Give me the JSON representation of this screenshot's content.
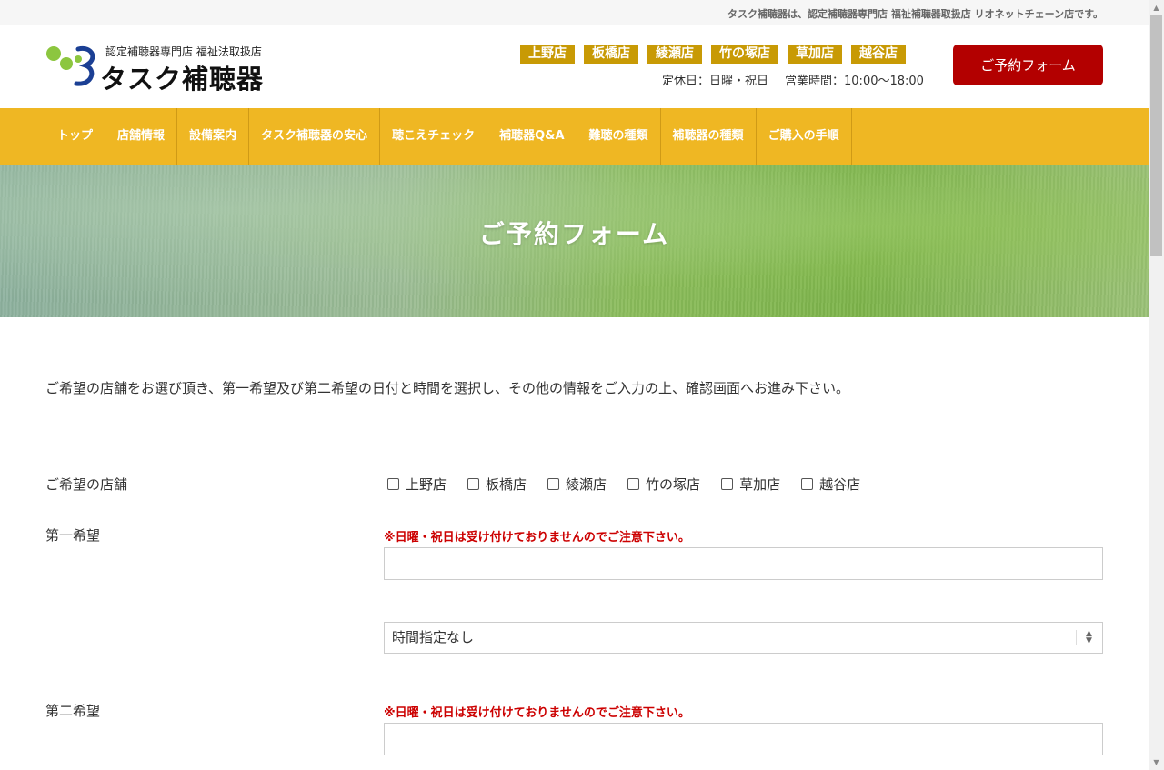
{
  "topbar": {
    "text": "タスク補聴器は、認定補聴器専門店 福祉補聴器取扱店 リオネットチェーン店です。"
  },
  "logo": {
    "subtitle": "認定補聴器専門店 福祉法取扱店",
    "name": "タスク補聴器",
    "colors": {
      "green": "#8cc63f",
      "blue": "#1b3f94"
    }
  },
  "stores": [
    "上野店",
    "板橋店",
    "綾瀬店",
    "竹の塚店",
    "草加店",
    "越谷店"
  ],
  "hours": {
    "closed": "定休日：日曜・祝日",
    "open": "営業時間：10:00～18:00"
  },
  "header": {
    "reserve_label": "ご予約フォーム"
  },
  "nav": [
    "トップ",
    "店舗情報",
    "設備案内",
    "タスク補聴器の安心",
    "聴こえチェック",
    "補聴器Q&A",
    "難聴の種類",
    "補聴器の種類",
    "ご購入の手順"
  ],
  "hero": {
    "title": "ご予約フォーム"
  },
  "form": {
    "intro": "ご希望の店舗をお選び頂き、第一希望及び第二希望の日付と時間を選択し、その他の情報をご入力の上、確認画面へお進み下さい。",
    "store_label": "ご希望の店舗",
    "first_label": "第一希望",
    "second_label": "第二希望",
    "warning": "※日曜・祝日は受け付けておりませんのでご注意下さい。",
    "time_default": "時間指定なし"
  },
  "colors": {
    "nav_bg": "#efb723",
    "store_tag": "#c89a05",
    "reserve_btn": "#b30000",
    "warning": "#cc0000"
  }
}
